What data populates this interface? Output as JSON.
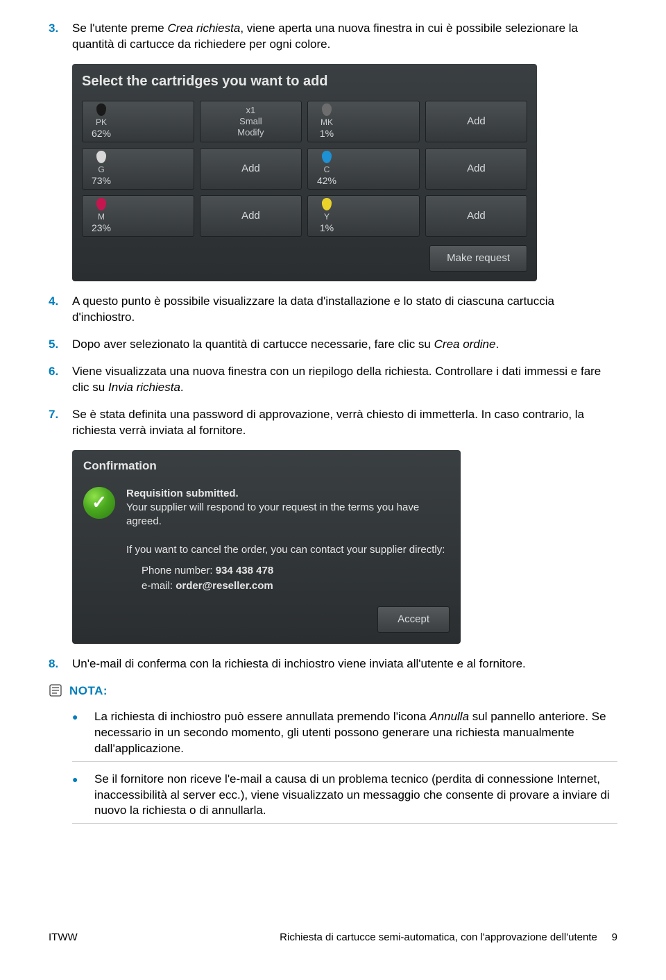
{
  "steps": {
    "s3": {
      "num": "3.",
      "pre": "Se l'utente preme ",
      "em": "Crea richiesta",
      "post": ", viene aperta una nuova finestra in cui è possibile selezionare la quantità di cartucce da richiedere per ogni colore."
    },
    "s4": {
      "num": "4.",
      "text": "A questo punto è possibile visualizzare la data d'installazione e lo stato di ciascuna cartuccia d'inchiostro."
    },
    "s5": {
      "num": "5.",
      "pre": "Dopo aver selezionato la quantità di cartucce necessarie, fare clic su ",
      "em": "Crea ordine",
      "post": "."
    },
    "s6": {
      "num": "6.",
      "pre": "Viene visualizzata una nuova finestra con un riepilogo della richiesta. Controllare i dati immessi e fare clic su ",
      "em": "Invia richiesta",
      "post": "."
    },
    "s7": {
      "num": "7.",
      "text": "Se è stata definita una password di approvazione, verrà chiesto di immetterla. In caso contrario, la richiesta verrà inviata al fornitore."
    },
    "s8": {
      "num": "8.",
      "text": "Un'e-mail di conferma con la richiesta di inchiostro viene inviata all'utente e al fornitore."
    }
  },
  "shot1": {
    "title": "Select the cartridges you want to add",
    "pk": {
      "label": "PK",
      "pct": "62%"
    },
    "x1": {
      "line1": "x1",
      "line2": "Small",
      "line3": "Modify"
    },
    "mk": {
      "label": "MK",
      "pct": "1%"
    },
    "g": {
      "label": "G",
      "pct": "73%"
    },
    "c": {
      "label": "C",
      "pct": "42%"
    },
    "m": {
      "label": "M",
      "pct": "23%"
    },
    "y": {
      "label": "Y",
      "pct": "1%"
    },
    "add": "Add",
    "make": "Make request"
  },
  "shot2": {
    "title": "Confirmation",
    "head": "Requisition submitted.",
    "body": "Your supplier will respond to your request in the terms you have agreed.",
    "cancel": "If you want to cancel the order, you can contact your supplier directly:",
    "phone_l": "Phone number: ",
    "phone_v": "934 438 478",
    "mail_l": "e-mail: ",
    "mail_v": "order@reseller.com",
    "accept": "Accept"
  },
  "note": {
    "label": "NOTA:",
    "n1": {
      "pre": "La richiesta di inchiostro può essere annullata premendo l'icona ",
      "em": "Annulla",
      "post": " sul pannello anteriore. Se necessario in un secondo momento, gli utenti possono generare una richiesta manualmente dall'applicazione."
    },
    "n2": "Se il fornitore non riceve l'e-mail a causa di un problema tecnico (perdita di connessione Internet, inaccessibilità al server ecc.), viene visualizzato un messaggio che consente di provare a inviare di nuovo la richiesta o di annullarla."
  },
  "footer": {
    "left": "ITWW",
    "center": "Richiesta di cartucce semi-automatica, con l'approvazione dell'utente",
    "page": "9"
  }
}
